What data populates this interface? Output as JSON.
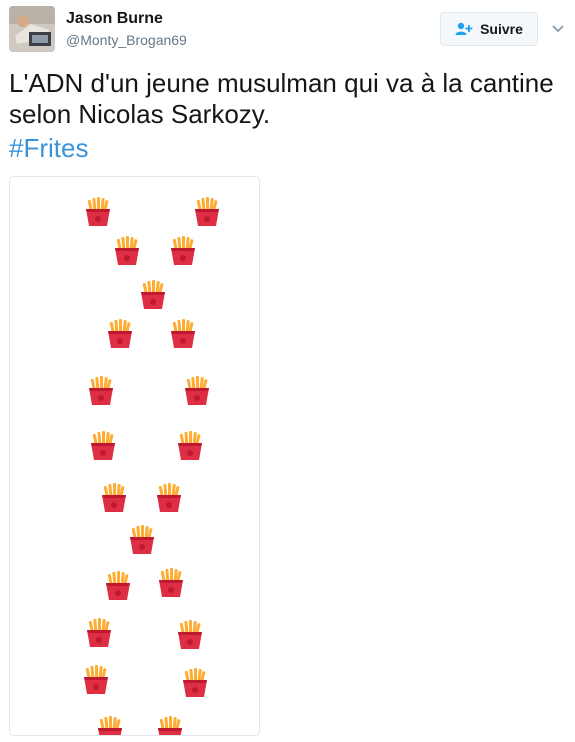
{
  "tweet": {
    "author_name": "Jason Burne",
    "author_handle": "@Monty_Brogan69",
    "follow_label": "Suivre",
    "text": "L'ADN d'un jeune musulman qui va à la cantine selon Nicolas Sarkozy.",
    "hashtag": "#Frites"
  },
  "media": {
    "emoji_icon": "french-fries-icon",
    "emoji_count": 22
  },
  "colors": {
    "hashtag": "#3b94d9",
    "follow_border": "#e1e8ed",
    "fries_box": "#dd2e44",
    "fries": "#ffac33"
  }
}
